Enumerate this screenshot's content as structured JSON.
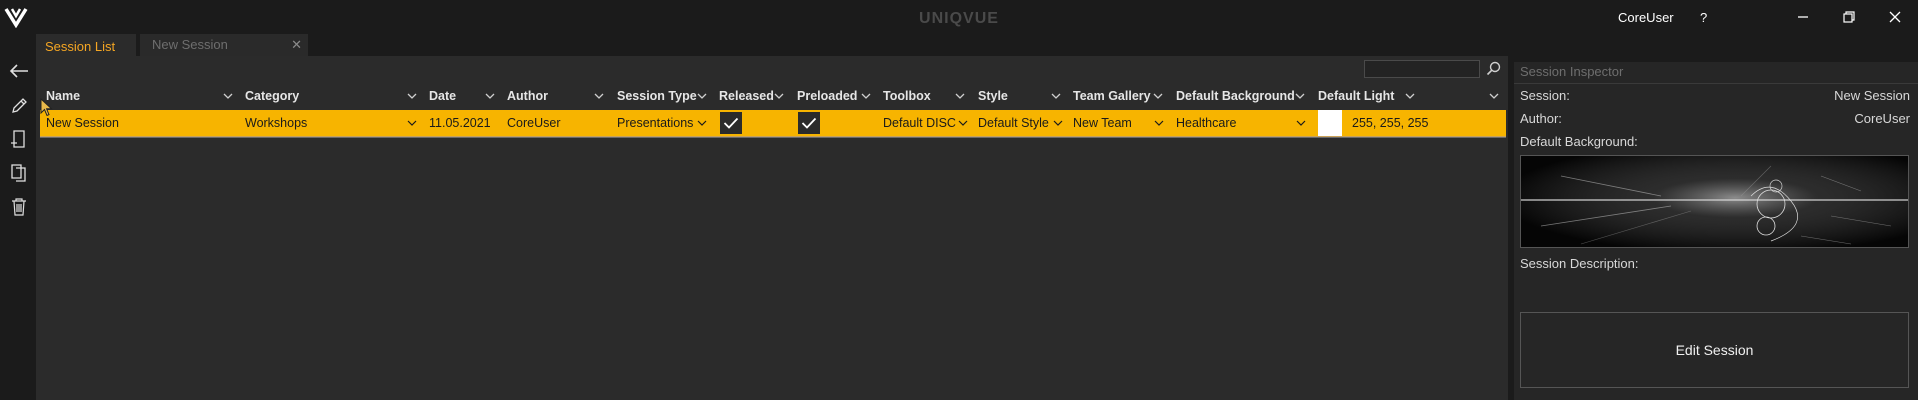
{
  "app": {
    "title": "UNIQVUE",
    "user": "CoreUser",
    "help": "?"
  },
  "tabs": [
    {
      "label": "Session List",
      "active": true
    },
    {
      "label": "New Session",
      "active": false
    }
  ],
  "sidebar": {
    "icons": [
      "arrow-left-icon",
      "pencil-icon",
      "new-document-icon",
      "copy-icon",
      "trash-icon"
    ]
  },
  "search": {
    "value": "",
    "placeholder": ""
  },
  "table": {
    "columns": [
      "Name",
      "Category",
      "Date",
      "Author",
      "Session Type",
      "Released",
      "Preloaded",
      "Toolbox",
      "Style",
      "Team Gallery",
      "Default Background",
      "Default Light"
    ],
    "rows": [
      {
        "name": "New Session",
        "category": "Workshops",
        "date": "11.05.2021",
        "author": "CoreUser",
        "session_type": "Presentations",
        "released": true,
        "preloaded": true,
        "toolbox": "Default DISC",
        "style": "Default Style",
        "team_gallery": "New Team",
        "default_background": "Healthcare",
        "default_light": "255, 255, 255"
      }
    ]
  },
  "inspector": {
    "title": "Session Inspector",
    "session_label": "Session:",
    "session_value": "New Session",
    "author_label": "Author:",
    "author_value": "CoreUser",
    "background_label": "Default Background:",
    "description_label": "Session Description:",
    "edit_button": "Edit Session"
  },
  "colors": {
    "accent": "#f7b400",
    "tab_active_text": "#f5a623",
    "background": "#1b1b1b",
    "panel": "#2b2b2b",
    "light_swatch": "#ffffff"
  }
}
